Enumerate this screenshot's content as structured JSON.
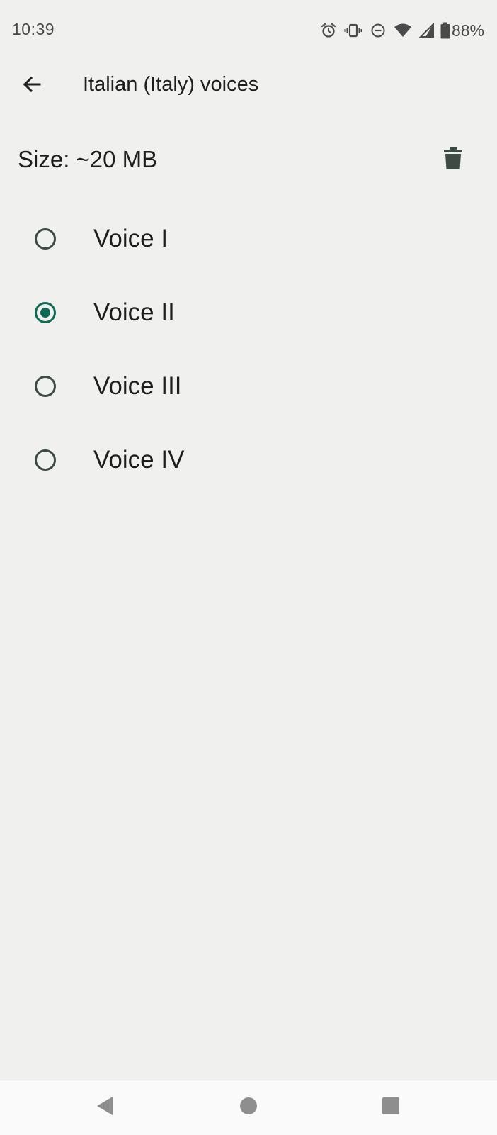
{
  "status_bar": {
    "time": "10:39",
    "battery_percent": "88%",
    "icons": [
      "alarm-icon",
      "vibrate-icon",
      "do-not-disturb-icon",
      "wifi-icon",
      "cell-signal-icon",
      "battery-icon"
    ]
  },
  "app_bar": {
    "title": "Italian (Italy) voices",
    "back_icon": "arrow-back-icon"
  },
  "size": {
    "text": "Size: ~20 MB",
    "delete_icon": "trash-icon"
  },
  "voices": [
    {
      "label": "Voice I",
      "selected": false
    },
    {
      "label": "Voice II",
      "selected": true
    },
    {
      "label": "Voice III",
      "selected": false
    },
    {
      "label": "Voice IV",
      "selected": false
    }
  ],
  "nav_bar": {
    "icons": [
      "nav-back-icon",
      "nav-home-icon",
      "nav-recents-icon"
    ]
  },
  "colors": {
    "background": "#f0f1ef",
    "accent": "#0b6b57",
    "text": "#1e1e1e",
    "icon": "#3e4a45"
  }
}
